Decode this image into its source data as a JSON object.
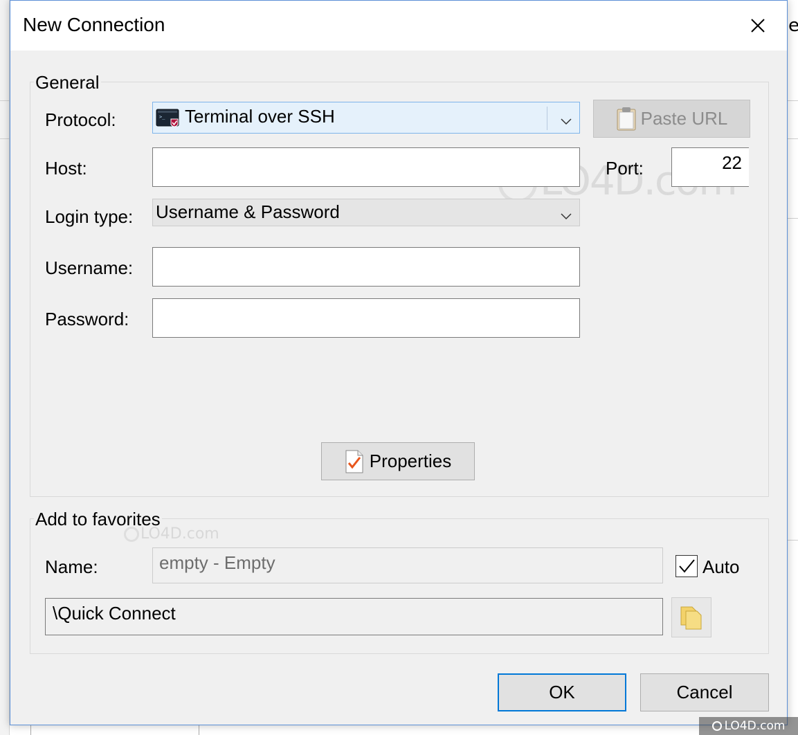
{
  "dialog": {
    "title": "New Connection",
    "close_icon": "close-icon"
  },
  "general": {
    "group_label": "General",
    "protocol": {
      "label": "Protocol:",
      "value": "Terminal over SSH",
      "icon": "terminal-ssh-icon"
    },
    "paste_url": {
      "label": "Paste URL",
      "icon": "clipboard-icon",
      "enabled": false
    },
    "host": {
      "label": "Host:",
      "value": ""
    },
    "port": {
      "label": "Port:",
      "value": "22"
    },
    "login_type": {
      "label": "Login type:",
      "value": "Username & Password"
    },
    "username": {
      "label": "Username:",
      "value": ""
    },
    "password": {
      "label": "Password:",
      "value": ""
    },
    "properties_button": {
      "label": "Properties",
      "icon": "checklist-icon"
    }
  },
  "favorites": {
    "group_label": "Add to favorites",
    "name": {
      "label": "Name:",
      "value": "empty - Empty"
    },
    "auto": {
      "label": "Auto",
      "checked": true
    },
    "folder": {
      "value": "\\Quick Connect",
      "icon": "folder-icon"
    }
  },
  "footer": {
    "ok_label": "OK",
    "cancel_label": "Cancel"
  },
  "watermark": {
    "center": "LO4D.com",
    "small": "LO4D.com",
    "corner": "LO4D.com"
  },
  "colors": {
    "accent": "#0078d7",
    "dialog_bg": "#f0f0f0",
    "check_orange": "#e8561c"
  }
}
